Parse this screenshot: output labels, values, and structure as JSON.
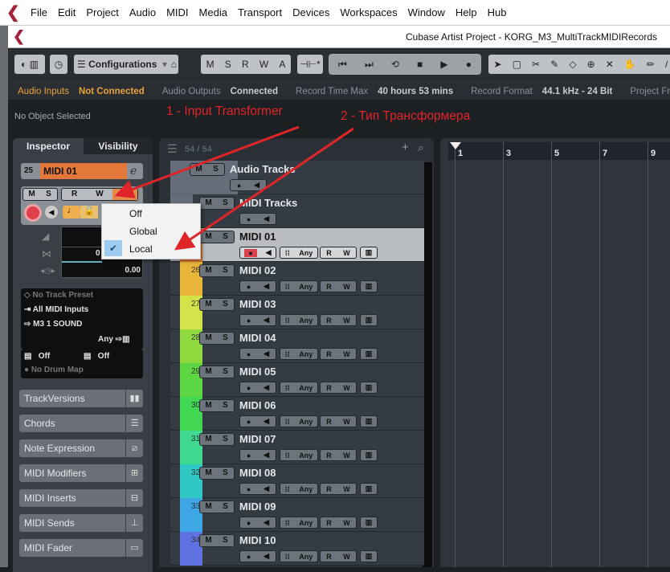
{
  "menu": [
    "File",
    "Edit",
    "Project",
    "Audio",
    "MIDI",
    "Media",
    "Transport",
    "Devices",
    "Workspaces",
    "Window",
    "Help",
    "Hub"
  ],
  "window_title": "Cubase Artist Project - KORG_M3_MultiTrackMIDIRecords",
  "toolbar": {
    "configurations": "Configurations",
    "msrwa": [
      "M",
      "S",
      "R",
      "W",
      "A"
    ]
  },
  "status": {
    "audio_inputs": "Audio Inputs",
    "audio_inputs_val": "Not Connected",
    "audio_outputs": "Audio Outputs",
    "audio_outputs_val": "Connected",
    "rec_time": "Record Time Max",
    "rec_time_val": "40 hours 53 mins",
    "rec_format": "Record Format",
    "rec_format_val": "44.1 kHz - 24 Bit",
    "project_f": "Project Fr"
  },
  "info_line": "No Object Selected",
  "annotations": {
    "a1": "1 - Input Transformer",
    "a2": "2 - Тип Трансформера"
  },
  "inspector": {
    "tab1": "Inspector",
    "tab2": "Visibility",
    "track_num": "25",
    "track_name": "MIDI 01",
    "m": "M",
    "s": "S",
    "r": "R",
    "w": "W",
    "pan_val": "0",
    "delay_val": "0.00",
    "preset": "No Track Preset",
    "input": "All MIDI Inputs",
    "output": "M3 1 SOUND",
    "channel": "Any",
    "bank": "Off",
    "program": "Off",
    "drum_map": "No Drum Map",
    "sections": [
      "TrackVersions",
      "Chords",
      "Note Expression",
      "MIDI Modifiers",
      "MIDI Inserts",
      "MIDI Sends",
      "MIDI Fader"
    ]
  },
  "popup": {
    "items": [
      "Off",
      "Global",
      "Local"
    ],
    "checked": "Local"
  },
  "tracklist": {
    "count": "54 / 54",
    "tracks": [
      {
        "name": "Audio Tracks",
        "num": "",
        "color": "#8a98a8",
        "type": "folder"
      },
      {
        "name": "MIDI Tracks",
        "num": "",
        "color": "#8a98a8",
        "type": "folder"
      },
      {
        "name": "MIDI 01",
        "num": "25",
        "color": "#e07a30",
        "type": "sel"
      },
      {
        "name": "MIDI 02",
        "num": "26",
        "color": "#e8b53a",
        "type": "midi"
      },
      {
        "name": "MIDI 03",
        "num": "27",
        "color": "#d4e24a",
        "type": "midi"
      },
      {
        "name": "MIDI 04",
        "num": "28",
        "color": "#8fd93e",
        "type": "midi"
      },
      {
        "name": "MIDI 05",
        "num": "29",
        "color": "#5cd642",
        "type": "midi"
      },
      {
        "name": "MIDI 06",
        "num": "30",
        "color": "#42d854",
        "type": "midi"
      },
      {
        "name": "MIDI 07",
        "num": "31",
        "color": "#3fd890",
        "type": "midi"
      },
      {
        "name": "MIDI 08",
        "num": "32",
        "color": "#30c8c4",
        "type": "midi"
      },
      {
        "name": "MIDI 09",
        "num": "33",
        "color": "#3fa6e6",
        "type": "midi"
      },
      {
        "name": "MIDI 10",
        "num": "34",
        "color": "#5f72e2",
        "type": "midi"
      }
    ],
    "any": "Any",
    "m": "M",
    "s": "S",
    "r": "R",
    "w": "W"
  },
  "ruler": [
    "1",
    "3",
    "5",
    "7",
    "9"
  ]
}
